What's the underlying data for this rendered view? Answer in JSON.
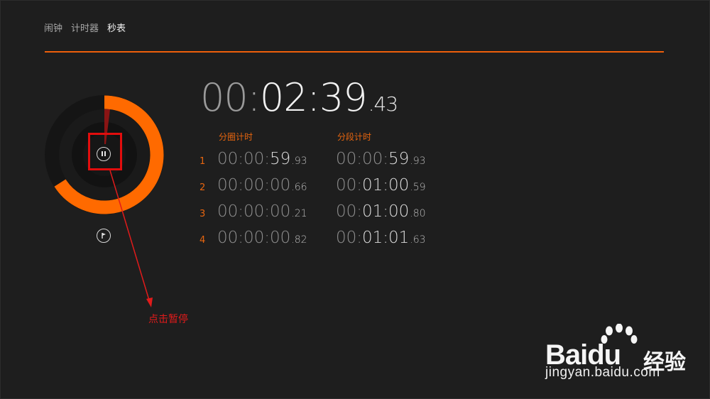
{
  "nav": {
    "tabs": [
      {
        "label": "闹钟",
        "active": false
      },
      {
        "label": "计时器",
        "active": false
      },
      {
        "label": "秒表",
        "active": true
      }
    ]
  },
  "stopwatch": {
    "main": {
      "hh": "00",
      "sep1": ":",
      "mm": "02",
      "sep2": ":",
      "ss": "39",
      "ms": ".43"
    },
    "progress_fraction": 0.66,
    "lap_header": "分圈计时",
    "split_header": "分段计时",
    "laps": [
      {
        "num": "1",
        "lap": {
          "dim": "00:00:",
          "bright": "59",
          "ms": ".93"
        },
        "split": {
          "dim": "00:00:",
          "bright": "59",
          "ms": ".93"
        }
      },
      {
        "num": "2",
        "lap": {
          "dim": "00:00:00",
          "bright": "",
          "ms": ".66"
        },
        "split": {
          "dim": "00:",
          "bright": "01:00",
          "ms": ".59"
        }
      },
      {
        "num": "3",
        "lap": {
          "dim": "00:00:00",
          "bright": "",
          "ms": ".21"
        },
        "split": {
          "dim": "00:",
          "bright": "01:00",
          "ms": ".80"
        }
      },
      {
        "num": "4",
        "lap": {
          "dim": "00:00:00",
          "bright": "",
          "ms": ".82"
        },
        "split": {
          "dim": "00:",
          "bright": "01:01",
          "ms": ".63"
        }
      }
    ]
  },
  "annotation": {
    "text": "点击暂停"
  },
  "watermark": {
    "logo": "Bai",
    "logo2": "du",
    "cn": "经验",
    "url": "jingyan.baidu.com"
  },
  "colors": {
    "accent": "#ee5f0b",
    "annotation": "#e11b1b",
    "background": "#1e1e1e"
  },
  "icons": {
    "pause": "pause-icon",
    "lap": "flag-icon"
  }
}
